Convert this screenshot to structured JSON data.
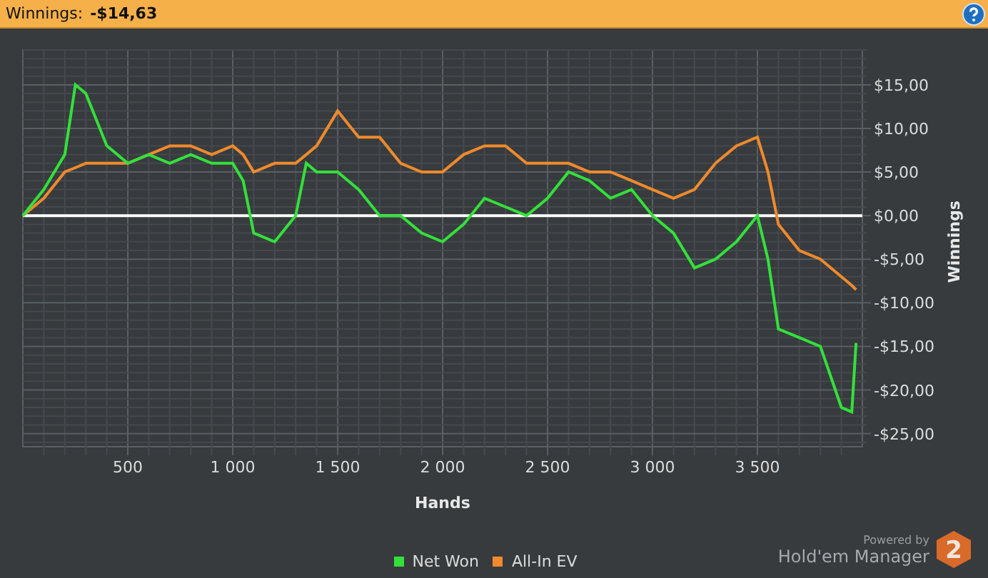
{
  "header": {
    "label": "Winnings:",
    "value": "-$14,63"
  },
  "chart": {
    "chart_data": {
      "type": "line",
      "xlabel": "Hands",
      "ylabel": "Winnings",
      "x": [
        0,
        100,
        200,
        250,
        300,
        400,
        500,
        600,
        700,
        800,
        900,
        1000,
        1050,
        1100,
        1200,
        1300,
        1350,
        1400,
        1500,
        1600,
        1700,
        1800,
        1900,
        2000,
        2100,
        2200,
        2300,
        2400,
        2500,
        2600,
        2700,
        2800,
        2900,
        3000,
        3100,
        3200,
        3300,
        3400,
        3500,
        3550,
        3600,
        3700,
        3800,
        3900,
        3950,
        3970
      ],
      "series": [
        {
          "name": "Net Won",
          "color": "#33e03a",
          "values": [
            0,
            3,
            7,
            15,
            14,
            8,
            6,
            7,
            6,
            7,
            6,
            6,
            4,
            -2,
            -3,
            0,
            6,
            5,
            5,
            3,
            0,
            0,
            -2,
            -3,
            -1,
            2,
            1,
            0,
            2,
            5,
            4,
            2,
            3,
            0,
            -2,
            -6,
            -5,
            -3,
            0,
            -5,
            -13,
            -14,
            -15,
            -22,
            -22.5,
            -14.6
          ]
        },
        {
          "name": "All-In EV",
          "color": "#f08a2c",
          "values": [
            0,
            2,
            5,
            5.5,
            6,
            6,
            6,
            7,
            8,
            8,
            7,
            8,
            7,
            5,
            6,
            6,
            7,
            8,
            12,
            9,
            9,
            6,
            5,
            5,
            7,
            8,
            8,
            6,
            6,
            6,
            5,
            5,
            4,
            3,
            2,
            3,
            6,
            8,
            9,
            5,
            -1,
            -4,
            -5,
            -7,
            -8,
            -8.5
          ]
        }
      ],
      "grid": true,
      "xlim": [
        0,
        4000
      ],
      "ylim": [
        -26.5,
        19
      ],
      "xticks": [
        {
          "value": 500,
          "label": "500"
        },
        {
          "value": 1000,
          "label": "1 000"
        },
        {
          "value": 1500,
          "label": "1 500"
        },
        {
          "value": 2000,
          "label": "2 000"
        },
        {
          "value": 2500,
          "label": "2 500"
        },
        {
          "value": 3000,
          "label": "3 000"
        },
        {
          "value": 3500,
          "label": "3 500"
        }
      ],
      "yticks": [
        {
          "value": 15,
          "label": "$15,00"
        },
        {
          "value": 10,
          "label": "$10,00"
        },
        {
          "value": 5,
          "label": "$5,00"
        },
        {
          "value": 0,
          "label": "$0,00"
        },
        {
          "value": -5,
          "label": "-$5,00"
        },
        {
          "value": -10,
          "label": "-$10,00"
        },
        {
          "value": -15,
          "label": "-$15,00"
        },
        {
          "value": -20,
          "label": "-$20,00"
        },
        {
          "value": -25,
          "label": "-$25,00"
        }
      ]
    }
  },
  "branding": {
    "tagline": "Powered by",
    "product": "Hold'em Manager",
    "badge": "2"
  }
}
